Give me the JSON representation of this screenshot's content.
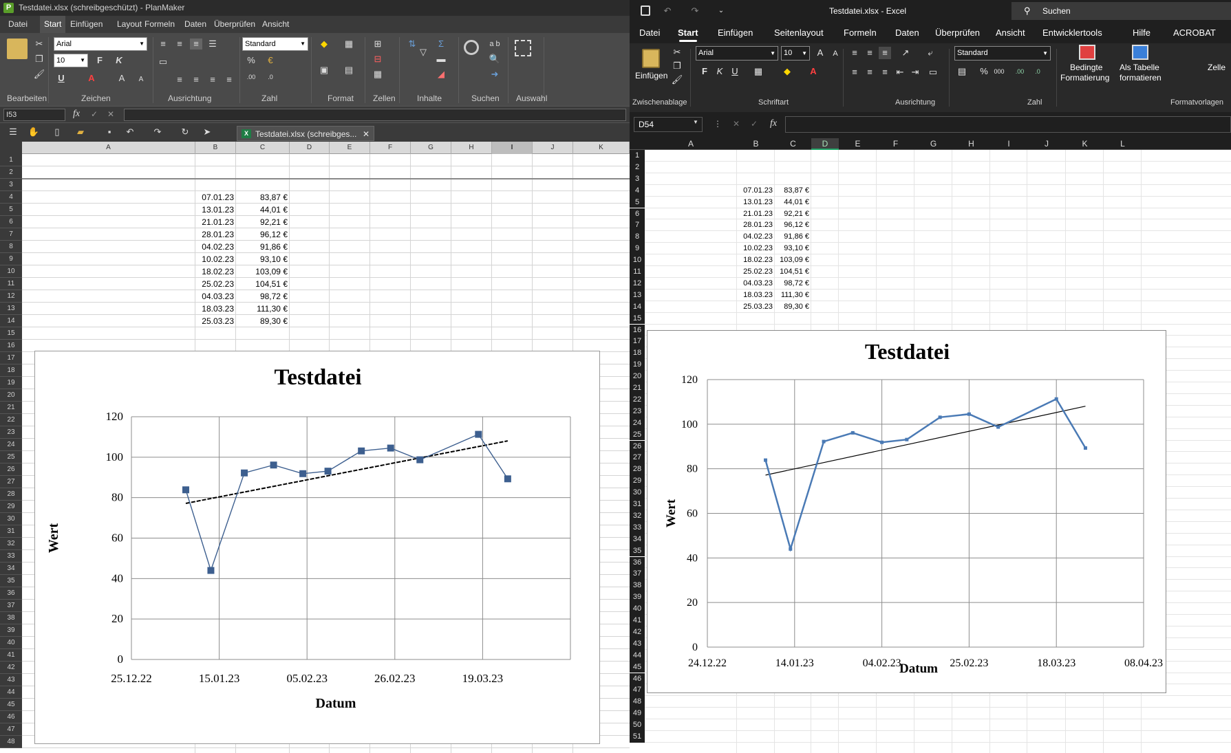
{
  "planmaker": {
    "window_title": "Testdatei.xlsx (schreibgeschützt) - PlanMaker",
    "logo_letter": "P",
    "menu": [
      "Datei",
      "Start",
      "Einfügen",
      "Layout",
      "Formeln",
      "Daten",
      "Überprüfen",
      "Ansicht"
    ],
    "active_menu": "Start",
    "ribbon_groups": [
      "Bearbeiten",
      "Zeichen",
      "Ausrichtung",
      "Zahl",
      "Format",
      "Zellen",
      "Inhalte",
      "Suchen",
      "Auswahl"
    ],
    "font_name": "Arial",
    "font_size": "10",
    "number_format": "Standard",
    "bold_label": "F",
    "italic_label": "K",
    "underline_label": "U",
    "search_hint": "a b",
    "cell_ref": "I53",
    "fx": "fx",
    "doc_tab": "Testdatei.xlsx (schreibges...",
    "columns": [
      "A",
      "B",
      "C",
      "D",
      "E",
      "F",
      "G",
      "H",
      "I",
      "J",
      "K"
    ],
    "rows": [
      "1",
      "2",
      "3",
      "4",
      "5",
      "6",
      "7",
      "8",
      "9",
      "10",
      "11",
      "12",
      "13",
      "14",
      "15",
      "16",
      "17",
      "18",
      "19",
      "20",
      "21",
      "22",
      "23",
      "24",
      "25",
      "26",
      "27",
      "28",
      "29",
      "30",
      "31",
      "32",
      "33",
      "34",
      "35",
      "36",
      "37",
      "38",
      "39",
      "40",
      "41",
      "42",
      "43",
      "44",
      "45",
      "46",
      "47",
      "48"
    ]
  },
  "excel": {
    "window_title": "Testdatei.xlsx  -  Excel",
    "search_placeholder": "Suchen",
    "menu": [
      "Datei",
      "Start",
      "Einfügen",
      "Seitenlayout",
      "Formeln",
      "Daten",
      "Überprüfen",
      "Ansicht",
      "Entwicklertools",
      "Hilfe",
      "ACROBAT"
    ],
    "active_menu": "Start",
    "ribbon_groups": [
      "Zwischenablage",
      "Schriftart",
      "Ausrichtung",
      "Zahl",
      "Formatvorlagen"
    ],
    "paste_label": "Einfügen",
    "font_name": "Arial",
    "font_size": "10",
    "number_format": "Standard",
    "bold_label": "F",
    "italic_label": "K",
    "underline_label": "U",
    "cond_format_label_1": "Bedingte",
    "cond_format_label_2": "Formatierung",
    "as_table_label_1": "Als Tabelle",
    "as_table_label_2": "formatieren",
    "cell_styles_label": "Zelle",
    "cell_ref": "D54",
    "fx": "fx",
    "columns": [
      "A",
      "B",
      "C",
      "D",
      "E",
      "F",
      "G",
      "H",
      "I",
      "J",
      "K",
      "L"
    ],
    "selected_column": "D",
    "rows": [
      "1",
      "2",
      "3",
      "4",
      "5",
      "6",
      "7",
      "8",
      "9",
      "10",
      "11",
      "12",
      "13",
      "14",
      "15",
      "16",
      "17",
      "18",
      "19",
      "20",
      "21",
      "22",
      "23",
      "24",
      "25",
      "26",
      "27",
      "28",
      "29",
      "30",
      "31",
      "32",
      "33",
      "34",
      "35",
      "36",
      "37",
      "38",
      "39",
      "40",
      "41",
      "42",
      "43",
      "44",
      "45",
      "46",
      "47",
      "48",
      "49",
      "50",
      "51"
    ]
  },
  "table": {
    "dates": [
      "07.01.23",
      "13.01.23",
      "21.01.23",
      "28.01.23",
      "04.02.23",
      "10.02.23",
      "18.02.23",
      "25.02.23",
      "04.03.23",
      "18.03.23",
      "25.03.23"
    ],
    "values": [
      "83,87 €",
      "44,01 €",
      "92,21 €",
      "96,12 €",
      "91,86 €",
      "93,10 €",
      "103,09 €",
      "104,51 €",
      "98,72 €",
      "111,30 €",
      "89,30 €"
    ]
  },
  "chart_data": [
    {
      "type": "line",
      "title": "Testdatei",
      "xlabel": "Datum",
      "ylabel": "Wert",
      "x": [
        "2023-01-07",
        "2023-01-13",
        "2023-01-21",
        "2023-01-28",
        "2023-02-04",
        "2023-02-10",
        "2023-02-18",
        "2023-02-25",
        "2023-03-04",
        "2023-03-18",
        "2023-03-25"
      ],
      "series": [
        {
          "values": [
            83.87,
            44.01,
            92.21,
            96.12,
            91.86,
            93.1,
            103.09,
            104.51,
            98.72,
            111.3,
            89.3
          ]
        }
      ],
      "trendline": "linear",
      "xticks": [
        "25.12.22",
        "15.01.23",
        "05.02.23",
        "26.02.23",
        "19.03.23"
      ],
      "xlim": [
        "2022-12-25",
        "2023-04-09"
      ],
      "yticks": [
        0,
        20,
        40,
        60,
        80,
        100,
        120
      ],
      "ylim": [
        0,
        120
      ],
      "grid": true,
      "markers": "square",
      "color": "#3d5f8f"
    },
    {
      "type": "line",
      "title": "Testdatei",
      "xlabel": "Datum",
      "ylabel": "Wert",
      "x": [
        "2023-01-07",
        "2023-01-13",
        "2023-01-21",
        "2023-01-28",
        "2023-02-04",
        "2023-02-10",
        "2023-02-18",
        "2023-02-25",
        "2023-03-04",
        "2023-03-18",
        "2023-03-25"
      ],
      "series": [
        {
          "values": [
            83.87,
            44.01,
            92.21,
            96.12,
            91.86,
            93.1,
            103.09,
            104.51,
            98.72,
            111.3,
            89.3
          ]
        }
      ],
      "trendline": "linear",
      "xticks": [
        "24.12.22",
        "14.01.23",
        "04.02.23",
        "25.02.23",
        "18.03.23",
        "08.04.23"
      ],
      "xlim": [
        "2022-12-24",
        "2023-04-08"
      ],
      "yticks": [
        0,
        20,
        40,
        60,
        80,
        100,
        120
      ],
      "ylim": [
        0,
        120
      ],
      "grid": true,
      "color": "#4a7ab5"
    }
  ]
}
